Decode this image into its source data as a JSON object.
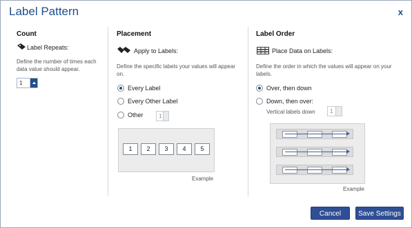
{
  "dialog": {
    "title": "Label Pattern",
    "close_label": "x"
  },
  "count": {
    "heading": "Count",
    "icon": "tag-icon",
    "label_repeats": "Label Repeats:",
    "description": "Define the number of times each data value should appear.",
    "repeats_value": "1"
  },
  "placement": {
    "heading": "Placement",
    "icon": "tags-icon",
    "apply_label": "Apply to Labels:",
    "description": "Define the specific labels your values will appear on.",
    "options": [
      {
        "label": "Every Label",
        "checked": true
      },
      {
        "label": "Every Other Label",
        "checked": false
      },
      {
        "label": "Other",
        "checked": false
      }
    ],
    "other_value": "1",
    "example_cells": [
      "1",
      "2",
      "3",
      "4",
      "5"
    ],
    "example_caption": "Example"
  },
  "label_order": {
    "heading": "Label Order",
    "icon": "grid-icon",
    "place_label": "Place Data on Labels:",
    "description": "Define the order in which the values will appear on your labels.",
    "options": [
      {
        "label": "Over, then down",
        "checked": true
      },
      {
        "label": "Down, then over:",
        "checked": false
      }
    ],
    "vertical_label": "Vertical labels down",
    "vertical_value": "1",
    "example_caption": "Example"
  },
  "footer": {
    "cancel_label": "Cancel",
    "save_label": "Save Settings",
    "button_color": "#2f4f95"
  },
  "colors": {
    "title": "#1f4e8c",
    "radio_checked": "#1f4e8c",
    "arrow": "#3f5ea3"
  }
}
